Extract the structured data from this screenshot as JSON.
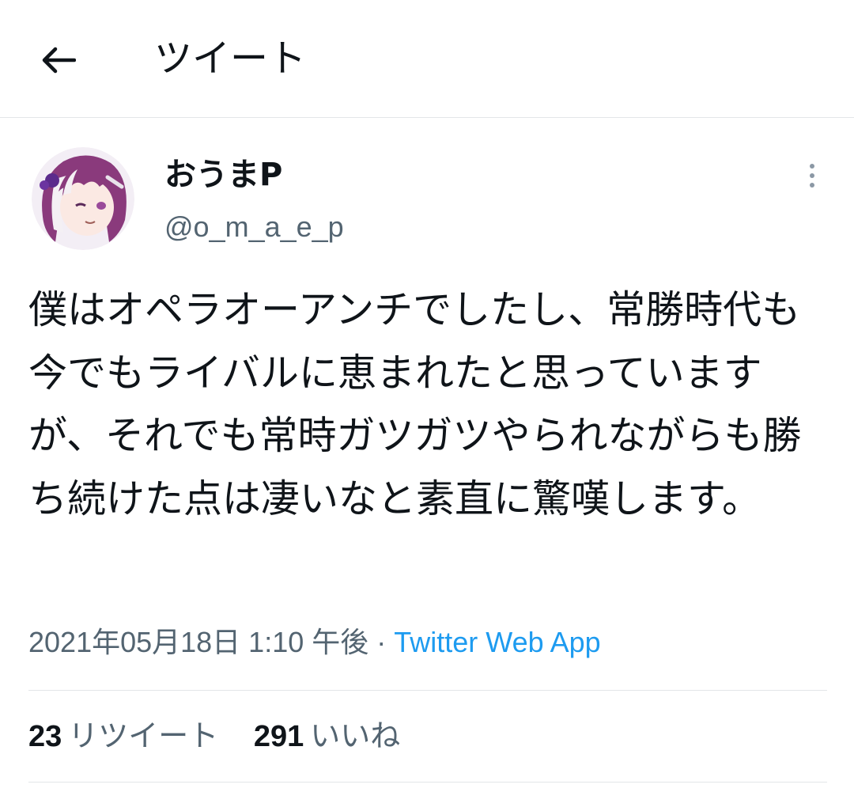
{
  "header": {
    "title": "ツイート",
    "back_icon": "arrow-left-icon"
  },
  "author": {
    "display_name": "おうまP",
    "handle": "@o_m_a_e_p",
    "avatar_icon": "avatar-illustration"
  },
  "tweet": {
    "text": "僕はオペラオーアンチでしたし、常勝時代も今でもライバルに恵まれたと思っていますが、それでも常時ガツガツやられながらも勝ち続けた点は凄いなと素直に驚嘆します。",
    "timestamp": "2021年05月18日 1:10 午後",
    "separator": " · ",
    "source": "Twitter Web App"
  },
  "stats": {
    "retweets_count": "23",
    "retweets_label": "リツイート",
    "likes_count": "291",
    "likes_label": "いいね"
  },
  "colors": {
    "text": "#0f1419",
    "secondary": "#536471",
    "link": "#1d9bf0",
    "divider": "#e3e6e8"
  }
}
